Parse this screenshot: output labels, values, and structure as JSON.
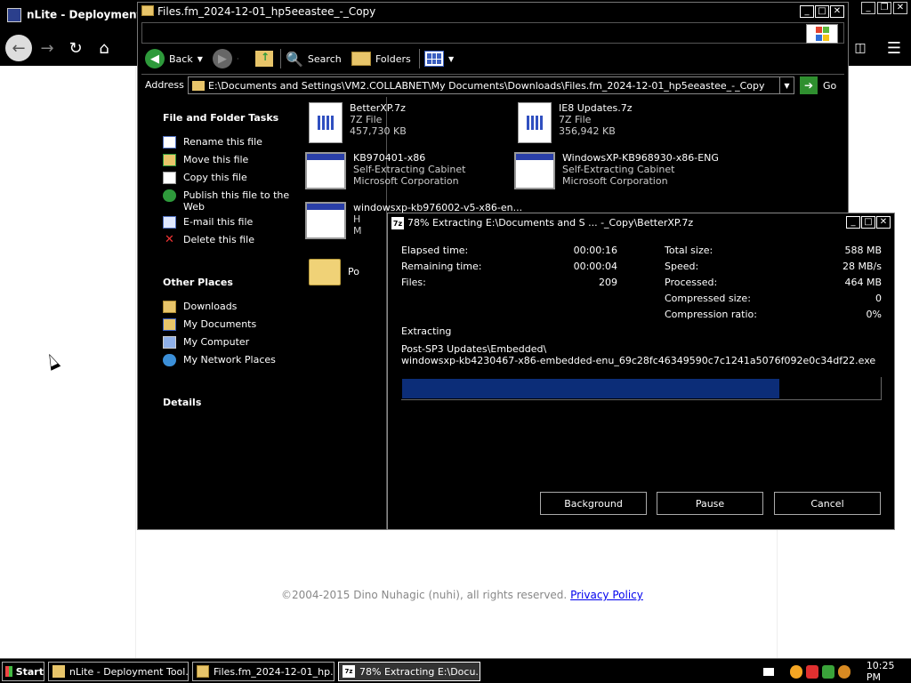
{
  "browser": {
    "title": "nLite - Deployment Tool",
    "footer_text": "©2004-2015 Dino Nuhagic (nuhi), all rights reserved.",
    "footer_link": "Privacy Policy"
  },
  "explorer": {
    "title": "Files.fm_2024-12-01_hp5eeastee_-_Copy",
    "toolbar": {
      "back": "Back",
      "search": "Search",
      "folders": "Folders"
    },
    "address": {
      "label": "Address",
      "value": "E:\\Documents and Settings\\VM2.COLLABNET\\My Documents\\Downloads\\Files.fm_2024-12-01_hp5eeastee_-_Copy",
      "go": "Go"
    },
    "left_panel": {
      "file_tasks_title": "File and Folder Tasks",
      "file_tasks": [
        {
          "label": "Rename this file",
          "icon": "rename-icon"
        },
        {
          "label": "Move this file",
          "icon": "move-icon"
        },
        {
          "label": "Copy this file",
          "icon": "copy-icon"
        },
        {
          "label": "Publish this file to the Web",
          "icon": "publish-icon"
        },
        {
          "label": "E-mail this file",
          "icon": "email-icon"
        },
        {
          "label": "Delete this file",
          "icon": "delete-icon"
        }
      ],
      "other_places_title": "Other Places",
      "other_places": [
        {
          "label": "Downloads",
          "icon": "folder-icon"
        },
        {
          "label": "My Documents",
          "icon": "my-documents-icon"
        },
        {
          "label": "My Computer",
          "icon": "my-computer-icon"
        },
        {
          "label": "My Network Places",
          "icon": "network-places-icon"
        }
      ],
      "details_title": "Details"
    },
    "files": [
      {
        "name": "BetterXP.7z",
        "line2": "7Z File",
        "line3": "457,730 KB"
      },
      {
        "name": "IE8 Updates.7z",
        "line2": "7Z File",
        "line3": "356,942 KB"
      },
      {
        "name": "KB970401-x86",
        "line2": "Self-Extracting Cabinet",
        "line3": "Microsoft Corporation"
      },
      {
        "name": "WindowsXP-KB968930-x86-ENG",
        "line2": "Self-Extracting Cabinet",
        "line3": "Microsoft Corporation"
      },
      {
        "name": "windowsxp-kb976002-v5-x86-en...",
        "line2": "H",
        "line3": "M"
      },
      {
        "name": "Po",
        "line2": "",
        "line3": ""
      }
    ]
  },
  "dialog": {
    "title": "78% Extracting E:\\Documents and S ... -_Copy\\BetterXP.7z",
    "icon": "7z",
    "left_stats": [
      {
        "label": "Elapsed time:",
        "value": "00:00:16"
      },
      {
        "label": "Remaining time:",
        "value": "00:00:04"
      },
      {
        "label": "Files:",
        "value": "209"
      }
    ],
    "right_stats": [
      {
        "label": "Total size:",
        "value": "588 MB"
      },
      {
        "label": "Speed:",
        "value": "28 MB/s"
      },
      {
        "label": "Processed:",
        "value": "464 MB"
      },
      {
        "label": "Compressed size:",
        "value": "0"
      },
      {
        "label": "Compression ratio:",
        "value": "0%"
      }
    ],
    "status": "Extracting",
    "path_line1": "Post-SP3 Updates\\Embedded\\",
    "path_line2": "windowsxp-kb4230467-x86-embedded-enu_69c28fc46349590c7c1241a5076f092e0c34df22.exe",
    "progress": 0.79,
    "buttons": {
      "background": "Background",
      "pause": "Pause",
      "cancel": "Cancel"
    }
  },
  "taskbar": {
    "start": "Start",
    "tasks": [
      {
        "label": "nLite - Deployment Tool..."
      },
      {
        "label": "Files.fm_2024-12-01_hp..."
      },
      {
        "label": "78% Extracting E:\\Docu..."
      }
    ],
    "clock": "10:25 PM"
  },
  "colors": {
    "progress": "#0c2d78",
    "folder": "#f0d277",
    "go_button": "#2f8f2f"
  }
}
